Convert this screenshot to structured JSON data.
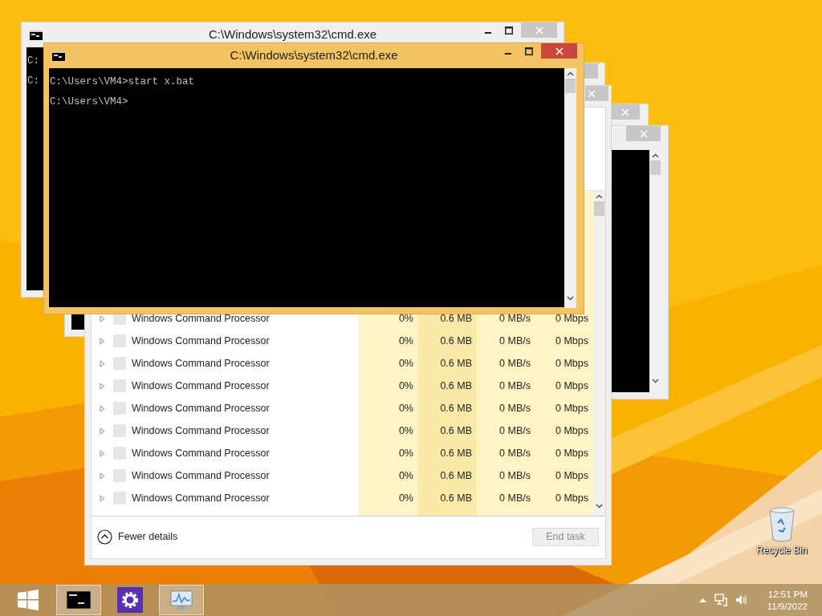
{
  "back_console": {
    "title": "C:\\Windows\\system32\\cmd.exe",
    "lines": [
      "C:",
      "C:"
    ]
  },
  "console": {
    "title": "C:\\Windows\\system32\\cmd.exe",
    "lines": [
      "C:\\Users\\VM4>start x.bat",
      "C:\\Users\\VM4>"
    ]
  },
  "task_manager": {
    "rows": [
      {
        "name": "Windows Command Processor",
        "cpu": "0%",
        "memory": "0.6 MB",
        "disk": "0 MB/s",
        "network": "0 Mbps",
        "expanded": false
      },
      {
        "name": "Windows Command Processor",
        "cpu": "0%",
        "memory": "0.6 MB",
        "disk": "0 MB/s",
        "network": "0 Mbps",
        "expanded": false
      },
      {
        "name": "Windows Command Processor",
        "cpu": "0%",
        "memory": "0.6 MB",
        "disk": "0 MB/s",
        "network": "0 Mbps",
        "expanded": false
      },
      {
        "name": "Windows Command Processor",
        "cpu": "0%",
        "memory": "0.6 MB",
        "disk": "0 MB/s",
        "network": "0 Mbps",
        "expanded": false
      },
      {
        "name": "Windows Command Processor",
        "cpu": "0%",
        "memory": "0.6 MB",
        "disk": "0 MB/s",
        "network": "0 Mbps",
        "expanded": false
      },
      {
        "name": "Windows Command Processor",
        "cpu": "0%",
        "memory": "0.6 MB",
        "disk": "0 MB/s",
        "network": "0 Mbps",
        "expanded": false
      },
      {
        "name": "Windows Command Processor",
        "cpu": "0%",
        "memory": "0.6 MB",
        "disk": "0 MB/s",
        "network": "0 Mbps",
        "expanded": false
      },
      {
        "name": "Windows Command Processor",
        "cpu": "0%",
        "memory": "0.6 MB",
        "disk": "0 MB/s",
        "network": "0 Mbps",
        "expanded": false
      },
      {
        "name": "Windows Command Processor",
        "cpu": "0%",
        "memory": "0.6 MB",
        "disk": "0 MB/s",
        "network": "0 Mbps",
        "expanded": false
      }
    ],
    "details_toggle": "Fewer details",
    "end_task": {
      "label": "End task",
      "disabled": true
    }
  },
  "desktop_icons": [
    {
      "label": "Recycle Bin"
    }
  ],
  "taskbar": {
    "buttons": [
      {
        "kind": "console",
        "active": true
      },
      {
        "kind": "settings",
        "active": false
      },
      {
        "kind": "monitor",
        "active": true
      }
    ],
    "clock": {
      "time": "12:51 PM",
      "date": "11/9/2022"
    }
  }
}
